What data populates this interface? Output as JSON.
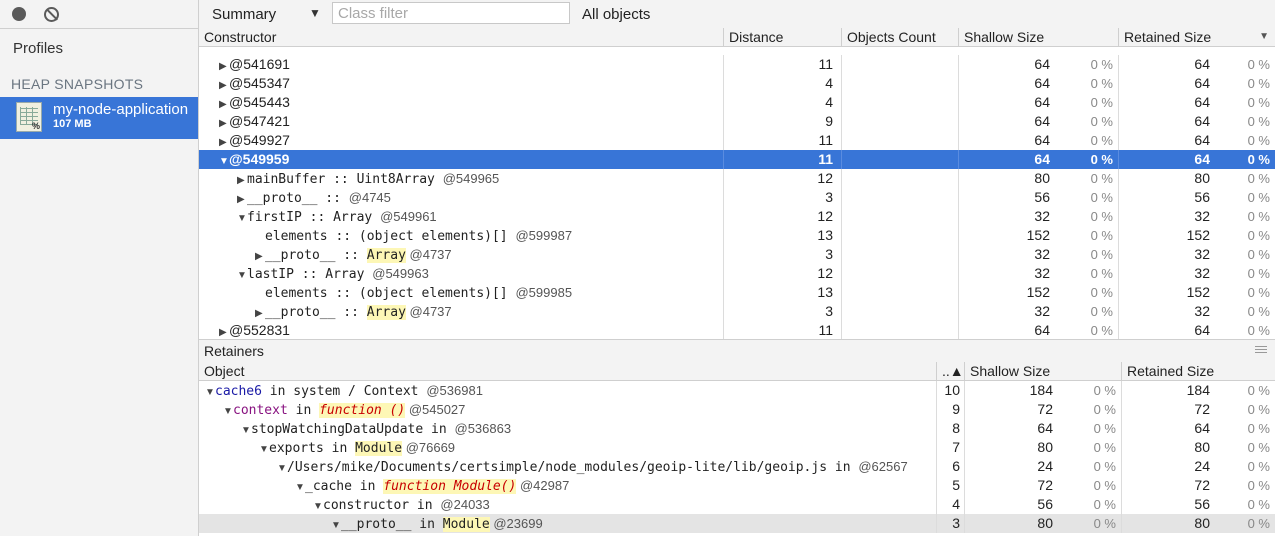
{
  "sidebar": {
    "profiles_label": "Profiles",
    "section_label": "HEAP SNAPSHOTS",
    "snapshot": {
      "name": "my-node-application",
      "size": "107 MB",
      "icon": "heap-snapshot-icon"
    }
  },
  "toolbar": {
    "view": "Summary",
    "filter_placeholder": "Class filter",
    "objects": "All objects"
  },
  "top_grid": {
    "headers": [
      "Constructor",
      "Distance",
      "Objects Count",
      "Shallow Size",
      "Retained Size"
    ],
    "rows": [
      {
        "tri": "▶",
        "name": "@541691",
        "dist": "11",
        "sh": "64",
        "shp": "0 %",
        "rt": "64",
        "rtp": "0 %"
      },
      {
        "tri": "▶",
        "name": "@545347",
        "dist": "4",
        "sh": "64",
        "shp": "0 %",
        "rt": "64",
        "rtp": "0 %"
      },
      {
        "tri": "▶",
        "name": "@545443",
        "dist": "4",
        "sh": "64",
        "shp": "0 %",
        "rt": "64",
        "rtp": "0 %"
      },
      {
        "tri": "▶",
        "name": "@547421",
        "dist": "9",
        "sh": "64",
        "shp": "0 %",
        "rt": "64",
        "rtp": "0 %"
      },
      {
        "tri": "▶",
        "name": "@549927",
        "dist": "11",
        "sh": "64",
        "shp": "0 %",
        "rt": "64",
        "rtp": "0 %"
      },
      {
        "tri": "▼",
        "name": "@549959",
        "dist": "11",
        "sh": "64",
        "shp": "0 %",
        "rt": "64",
        "rtp": "0 %",
        "selected": true
      },
      {
        "tri": "▶",
        "name": "mainBuffer",
        "sep": " :: Uint8Array ",
        "id": "@549965",
        "dist": "12",
        "sh": "80",
        "shp": "0 %",
        "rt": "80",
        "rtp": "0 %",
        "indent": 1
      },
      {
        "tri": "▶",
        "name": "__proto__",
        "sep": " :: ",
        "id": "@4745",
        "dist": "3",
        "sh": "56",
        "shp": "0 %",
        "rt": "56",
        "rtp": "0 %",
        "indent": 1
      },
      {
        "tri": "▼",
        "name": "firstIP",
        "sep": " :: Array ",
        "id": "@549961",
        "dist": "12",
        "sh": "32",
        "shp": "0 %",
        "rt": "32",
        "rtp": "0 %",
        "indent": 1
      },
      {
        "tri": "",
        "name": "elements",
        "sep": " :: (object elements)[] ",
        "id": "@599987",
        "dist": "13",
        "sh": "152",
        "shp": "0 %",
        "rt": "152",
        "rtp": "0 %",
        "indent": 2
      },
      {
        "tri": "▶",
        "name": "__proto__",
        "sep": " :: ",
        "hl": "Array",
        "id": " @4737",
        "dist": "3",
        "sh": "32",
        "shp": "0 %",
        "rt": "32",
        "rtp": "0 %",
        "indent": 2
      },
      {
        "tri": "▼",
        "name": "lastIP",
        "sep": " :: Array ",
        "id": "@549963",
        "dist": "12",
        "sh": "32",
        "shp": "0 %",
        "rt": "32",
        "rtp": "0 %",
        "indent": 1
      },
      {
        "tri": "",
        "name": "elements",
        "sep": " :: (object elements)[] ",
        "id": "@599985",
        "dist": "13",
        "sh": "152",
        "shp": "0 %",
        "rt": "152",
        "rtp": "0 %",
        "indent": 2
      },
      {
        "tri": "▶",
        "name": "__proto__",
        "sep": " :: ",
        "hl": "Array",
        "id": " @4737",
        "dist": "3",
        "sh": "32",
        "shp": "0 %",
        "rt": "32",
        "rtp": "0 %",
        "indent": 2
      },
      {
        "tri": "▶",
        "name": "@552831",
        "dist": "11",
        "sh": "64",
        "shp": "0 %",
        "rt": "64",
        "rtp": "0 %"
      }
    ]
  },
  "retainers": {
    "title": "Retainers",
    "headers": [
      "Object",
      "..▲",
      "Shallow Size",
      "Retained Size"
    ],
    "rows": [
      {
        "name": "cache6",
        "kind": "cache",
        "mid": " in system / Context ",
        "id": "@536981",
        "dist": "10",
        "sh": "184",
        "shp": "0 %",
        "rt": "184",
        "rtp": "0 %",
        "indent": 0
      },
      {
        "name": "context",
        "kind": "prop",
        "mid": " in ",
        "fn": "function ()",
        "id": " @545027",
        "dist": "9",
        "sh": "72",
        "shp": "0 %",
        "rt": "72",
        "rtp": "0 %",
        "indent": 1
      },
      {
        "name": "stopWatchingDataUpdate",
        "mid": " in ",
        "id": "@536863",
        "dist": "8",
        "sh": "64",
        "shp": "0 %",
        "rt": "64",
        "rtp": "0 %",
        "indent": 2
      },
      {
        "name": "exports",
        "mid": " in ",
        "hl": "Module",
        "id": " @76669",
        "dist": "7",
        "sh": "80",
        "shp": "0 %",
        "rt": "80",
        "rtp": "0 %",
        "indent": 3
      },
      {
        "name": "/Users/mike/Documents/certsimple/node_modules/geoip-lite/lib/geoip.js",
        "mid": " in ",
        "id": "@62567",
        "dist": "6",
        "sh": "24",
        "shp": "0 %",
        "rt": "24",
        "rtp": "0 %",
        "indent": 4
      },
      {
        "name": "_cache",
        "mid": " in ",
        "fn": "function Module()",
        "id": " @42987",
        "dist": "5",
        "sh": "72",
        "shp": "0 %",
        "rt": "72",
        "rtp": "0 %",
        "indent": 5
      },
      {
        "name": "constructor",
        "mid": " in ",
        "id": "@24033",
        "dist": "4",
        "sh": "56",
        "shp": "0 %",
        "rt": "56",
        "rtp": "0 %",
        "indent": 6
      },
      {
        "name": "__proto__",
        "mid": " in ",
        "hl": "Module",
        "id": " @23699",
        "dist": "3",
        "sh": "80",
        "shp": "0 %",
        "rt": "80",
        "rtp": "0 %",
        "indent": 7,
        "highlight": true
      }
    ]
  }
}
